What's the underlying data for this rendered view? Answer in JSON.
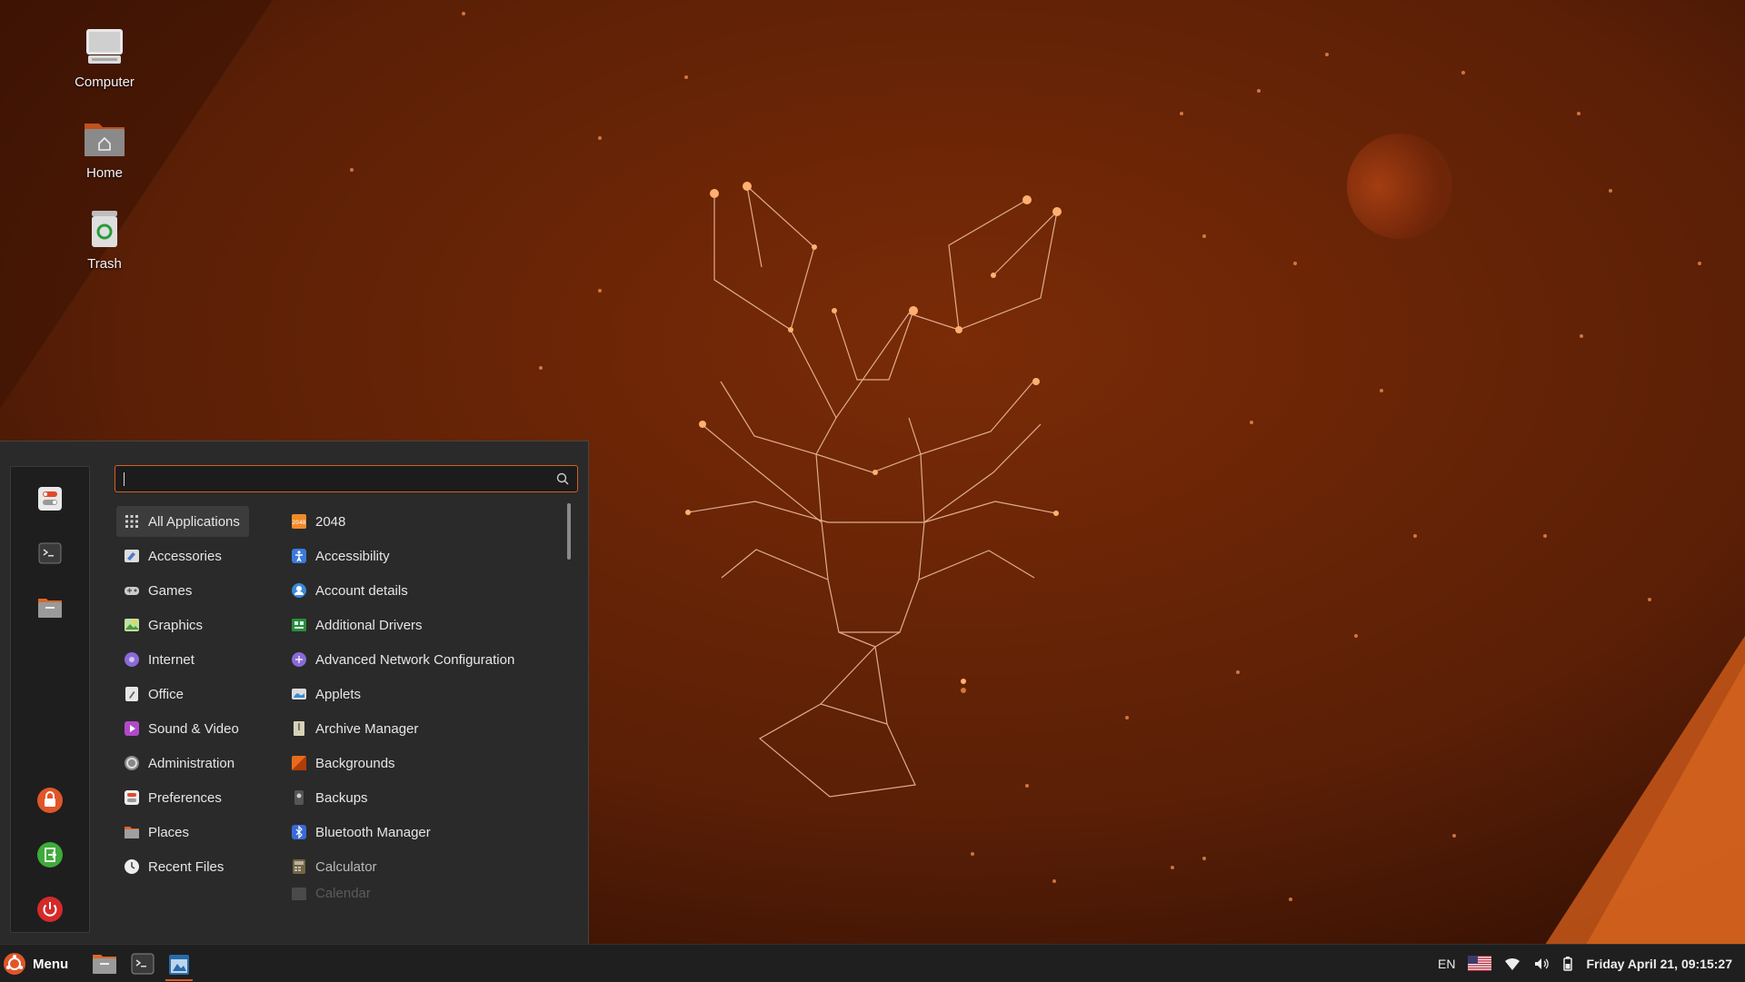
{
  "desktop": {
    "icons": [
      {
        "label": "Computer",
        "icon": "computer-icon"
      },
      {
        "label": "Home",
        "icon": "home-folder-icon"
      },
      {
        "label": "Trash",
        "icon": "trash-icon"
      }
    ]
  },
  "menu": {
    "search": {
      "placeholder": ""
    },
    "favorites": [
      "settings-icon",
      "terminal-icon",
      "files-icon"
    ],
    "session": [
      "lock-icon",
      "logout-icon",
      "power-icon"
    ],
    "categories": [
      {
        "label": "All Applications",
        "icon": "grid-icon",
        "selected": true
      },
      {
        "label": "Accessories",
        "icon": "accessories-icon"
      },
      {
        "label": "Games",
        "icon": "gamepad-icon"
      },
      {
        "label": "Graphics",
        "icon": "image-icon"
      },
      {
        "label": "Internet",
        "icon": "globe-icon"
      },
      {
        "label": "Office",
        "icon": "office-icon"
      },
      {
        "label": "Sound & Video",
        "icon": "play-icon"
      },
      {
        "label": "Administration",
        "icon": "admin-icon"
      },
      {
        "label": "Preferences",
        "icon": "preferences-icon"
      },
      {
        "label": "Places",
        "icon": "folder-icon"
      },
      {
        "label": "Recent Files",
        "icon": "clock-icon"
      }
    ],
    "apps": [
      {
        "label": "2048",
        "icon": "2048-icon"
      },
      {
        "label": "Accessibility",
        "icon": "accessibility-icon"
      },
      {
        "label": "Account details",
        "icon": "account-icon"
      },
      {
        "label": "Additional Drivers",
        "icon": "chip-icon"
      },
      {
        "label": "Advanced Network Configuration",
        "icon": "network-icon"
      },
      {
        "label": "Applets",
        "icon": "applets-icon"
      },
      {
        "label": "Archive Manager",
        "icon": "archive-icon"
      },
      {
        "label": "Backgrounds",
        "icon": "backgrounds-icon"
      },
      {
        "label": "Backups",
        "icon": "backups-icon"
      },
      {
        "label": "Bluetooth Manager",
        "icon": "bluetooth-icon"
      },
      {
        "label": "Calculator",
        "icon": "calculator-icon"
      },
      {
        "label": "Calendar",
        "icon": "calendar-icon"
      }
    ]
  },
  "taskbar": {
    "menu_label": "Menu",
    "launchers": [
      "files-icon",
      "terminal-icon",
      "app-window-icon"
    ],
    "tray": {
      "keyboard_layout": "EN",
      "flag": "us-flag-icon",
      "clock": "Friday April 21, 09:15:27"
    }
  },
  "colors": {
    "accent": "#d46024",
    "menu_bg": "#2a2a2a",
    "panel_bg": "#1f1f1f"
  }
}
